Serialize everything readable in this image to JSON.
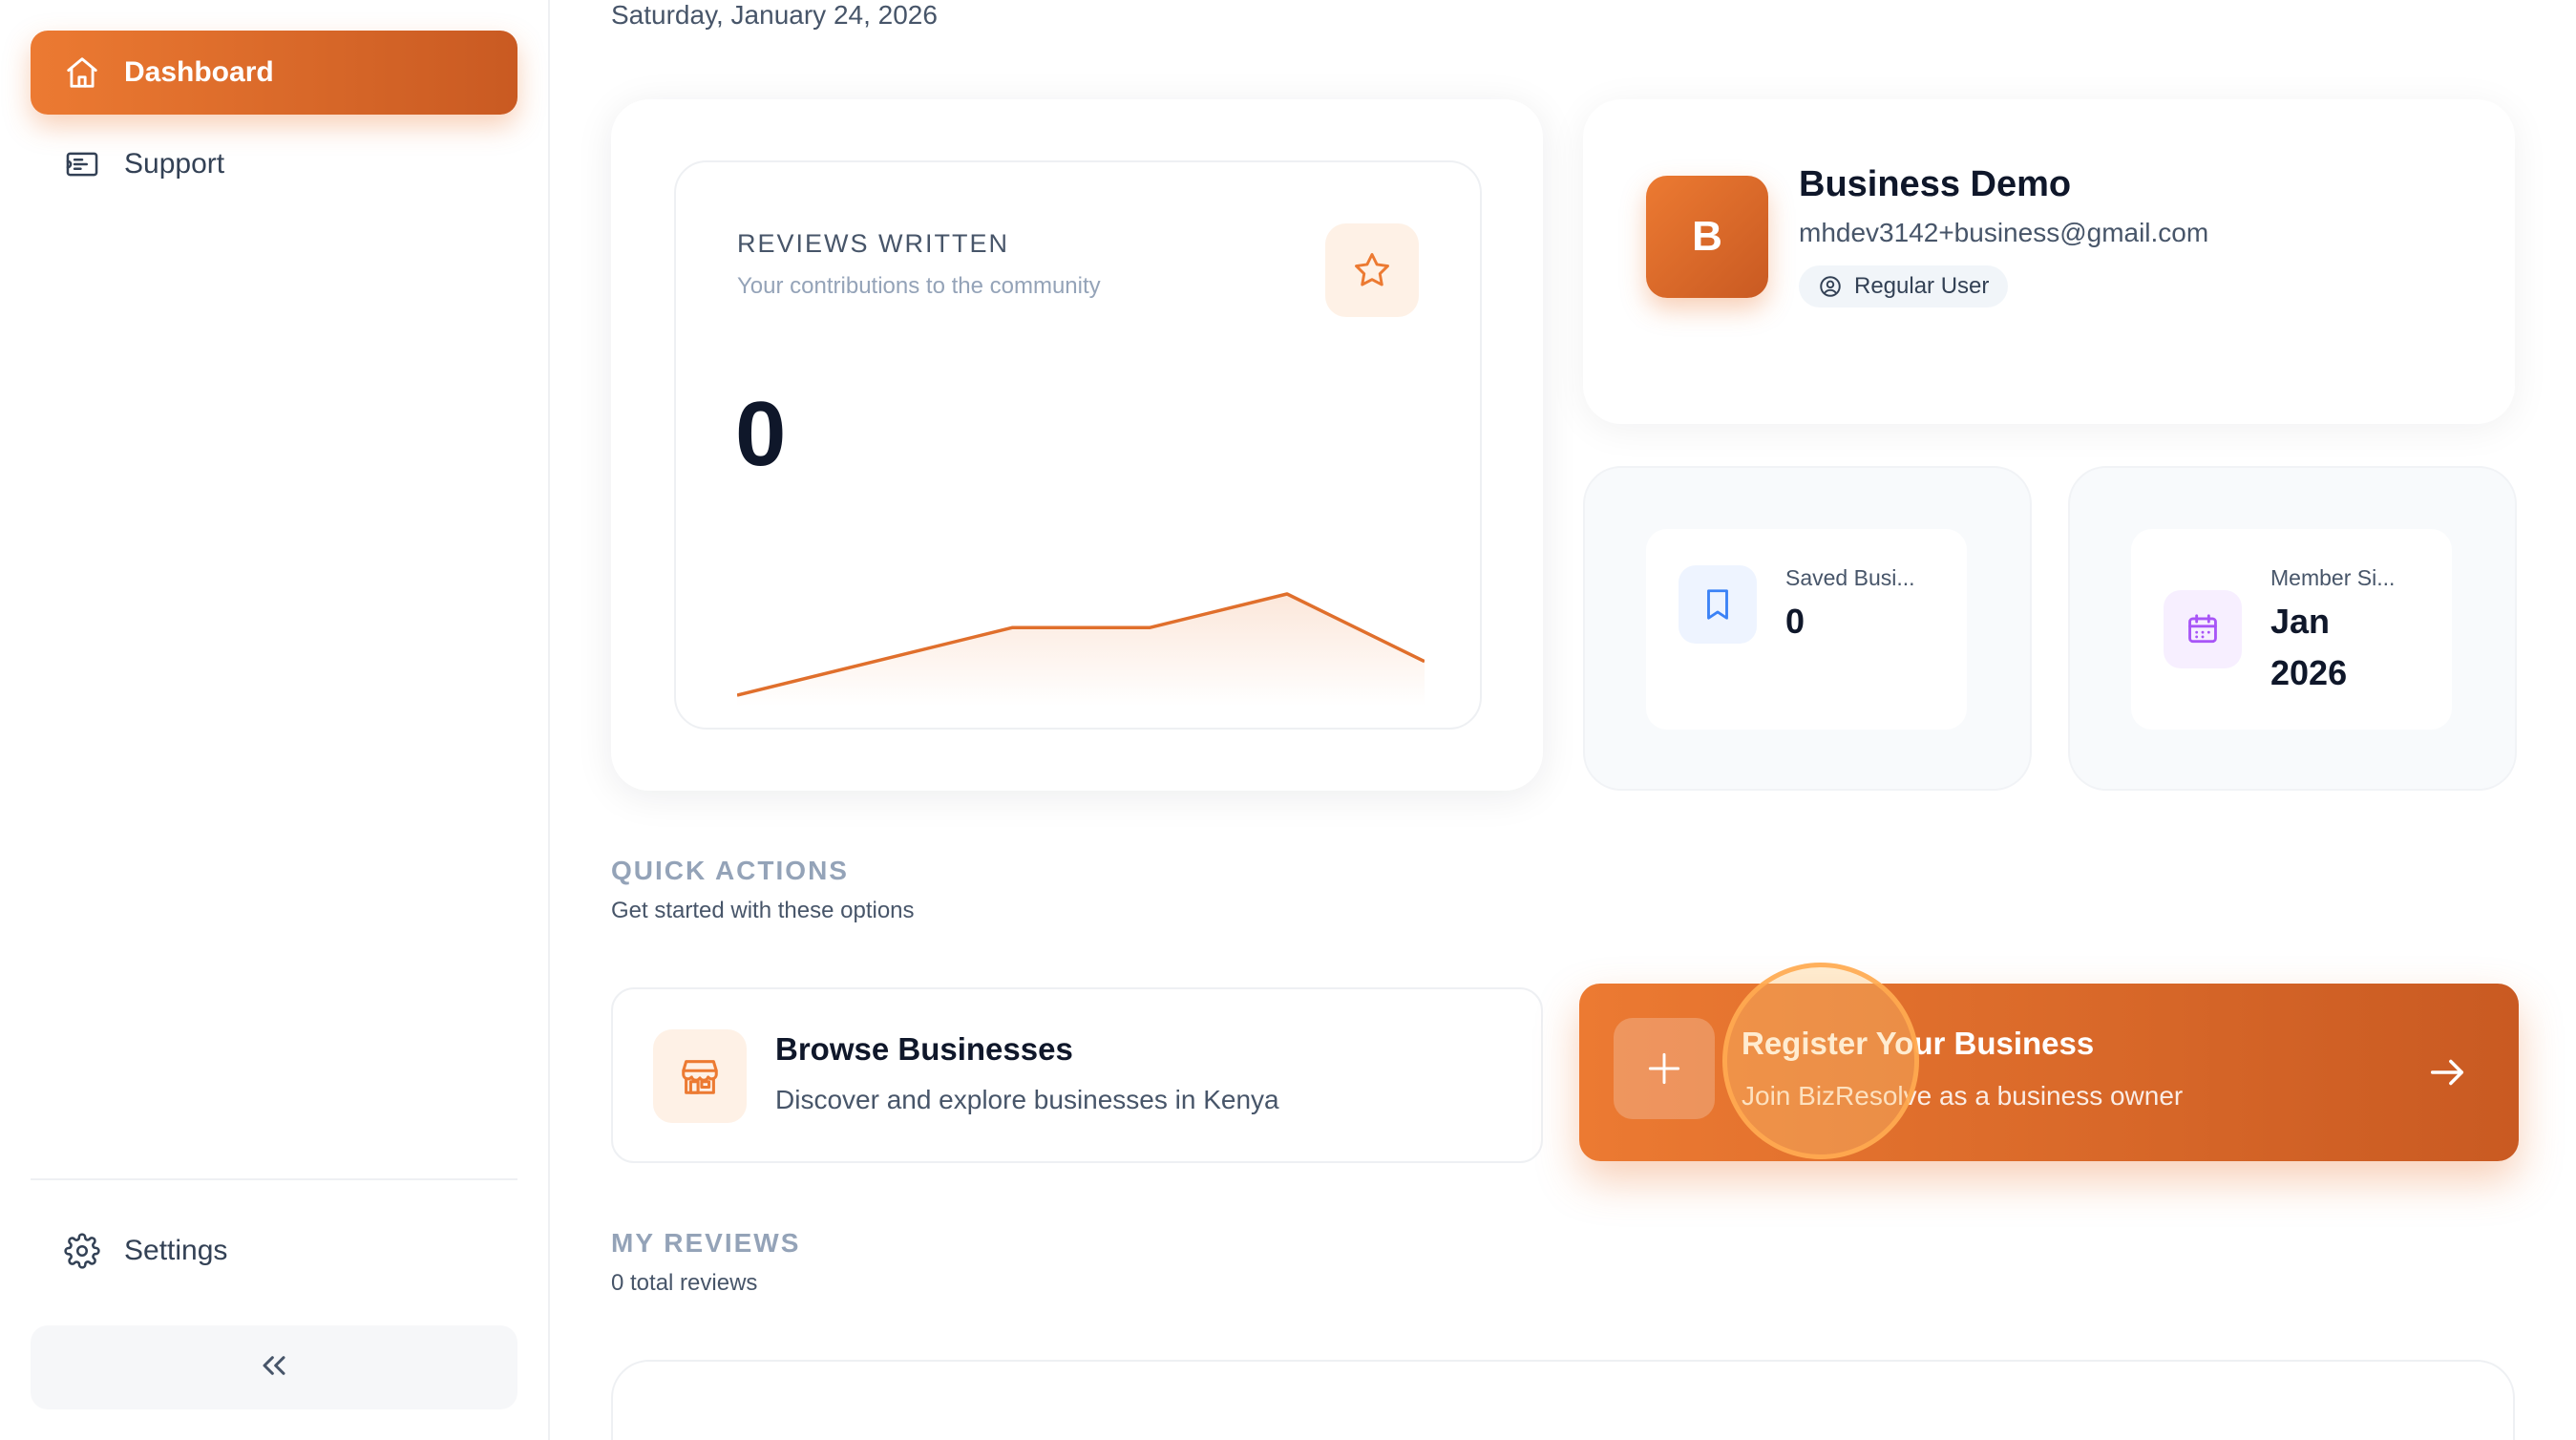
{
  "sidebar": {
    "items": [
      {
        "label": "Dashboard",
        "icon": "home-icon",
        "active": true
      },
      {
        "label": "Support",
        "icon": "ticket-icon",
        "active": false
      }
    ],
    "settings_label": "Settings",
    "collapse_icon": "chevrons-left-icon"
  },
  "header": {
    "date": "Saturday, January 24, 2026"
  },
  "reviews_written": {
    "title": "REVIEWS WRITTEN",
    "subtitle": "Your contributions to the community",
    "value": "0",
    "icon": "star-icon"
  },
  "chart_data": {
    "type": "line",
    "series": [
      {
        "values": [
          0,
          1,
          2,
          2,
          3,
          1
        ]
      }
    ]
  },
  "profile": {
    "initial": "B",
    "name": "Business Demo",
    "email": "mhdev3142+business@gmail.com",
    "role": "Regular User"
  },
  "stats": [
    {
      "label": "Saved Busi...",
      "value": "0",
      "icon": "bookmark-icon"
    },
    {
      "label": "Member Si...",
      "value_line1": "Jan",
      "value_line2": "2026",
      "icon": "calendar-icon"
    }
  ],
  "quick_actions": {
    "title": "QUICK ACTIONS",
    "subtitle": "Get started with these options",
    "browse": {
      "title": "Browse Businesses",
      "description": "Discover and explore businesses in Kenya",
      "icon": "store-icon"
    },
    "register": {
      "title": "Register Your Business",
      "description": "Join BizResolve as a business owner",
      "icon": "plus-icon"
    }
  },
  "my_reviews": {
    "title": "MY REVIEWS",
    "subtitle": "0 total reviews"
  },
  "colors": {
    "accent": "#ec7a32",
    "accent_dark": "#c95a22",
    "bookmark_blue": "#3b82f6",
    "calendar_purple": "#a855f7"
  }
}
